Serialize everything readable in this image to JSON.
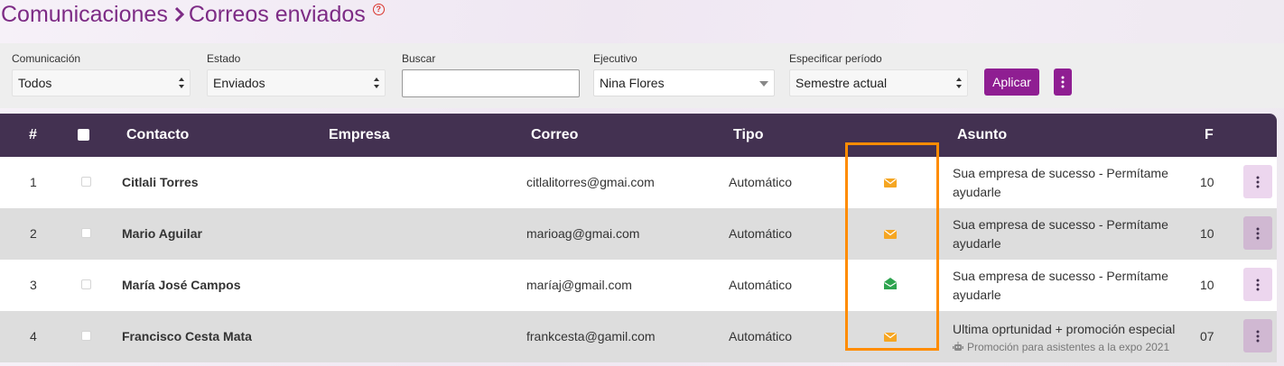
{
  "breadcrumb": {
    "section": "Comunicaciones",
    "page": "Correos enviados"
  },
  "filters": {
    "comunicacion": {
      "label": "Comunicación",
      "value": "Todos"
    },
    "estado": {
      "label": "Estado",
      "value": "Enviados"
    },
    "buscar": {
      "label": "Buscar",
      "value": "",
      "placeholder": ""
    },
    "ejecutivo": {
      "label": "Ejecutivo",
      "value": "Nina Flores"
    },
    "periodo": {
      "label": "Especificar período",
      "value": "Semestre actual"
    },
    "apply_label": "Aplicar"
  },
  "table": {
    "columns": [
      "#",
      "Contacto",
      "Empresa",
      "Correo",
      "Tipo",
      "Asunto",
      "F"
    ],
    "rows": [
      {
        "num": "1",
        "contacto": "Citlali Torres",
        "empresa": "",
        "correo": "citlalitorres@gmai.com",
        "tipo": "Automático",
        "status_icon": "envelope-closed-icon",
        "status_color": "#f5a623",
        "asunto": "Sua empresa de sucesso - Permítame ayudarle",
        "nota": "",
        "fecha": "10"
      },
      {
        "num": "2",
        "contacto": "Mario Aguilar",
        "empresa": "",
        "correo": "marioag@gmai.com",
        "tipo": "Automático",
        "status_icon": "envelope-closed-icon",
        "status_color": "#f5a623",
        "asunto": "Sua empresa de sucesso - Permítame ayudarle",
        "nota": "",
        "fecha": "10"
      },
      {
        "num": "3",
        "contacto": "María José Campos",
        "empresa": "",
        "correo": "maríaj@gmail.com",
        "tipo": "Automático",
        "status_icon": "envelope-open-icon",
        "status_color": "#2ea44f",
        "asunto": "Sua empresa de sucesso - Permítame ayudarle",
        "nota": "",
        "fecha": "10"
      },
      {
        "num": "4",
        "contacto": "Francisco Cesta Mata",
        "empresa": "",
        "correo": "frankcesta@gamil.com",
        "tipo": "Automático",
        "status_icon": "envelope-closed-icon",
        "status_color": "#f5a623",
        "asunto": "Ultima oprtunidad + promoción especial",
        "nota": "Promoción para asistentes a la expo 2021",
        "fecha": "07"
      }
    ]
  },
  "colors": {
    "accent": "#8f1e92",
    "title": "#7d2b85",
    "header_bg": "#433151",
    "highlight": "#ff8c00"
  }
}
